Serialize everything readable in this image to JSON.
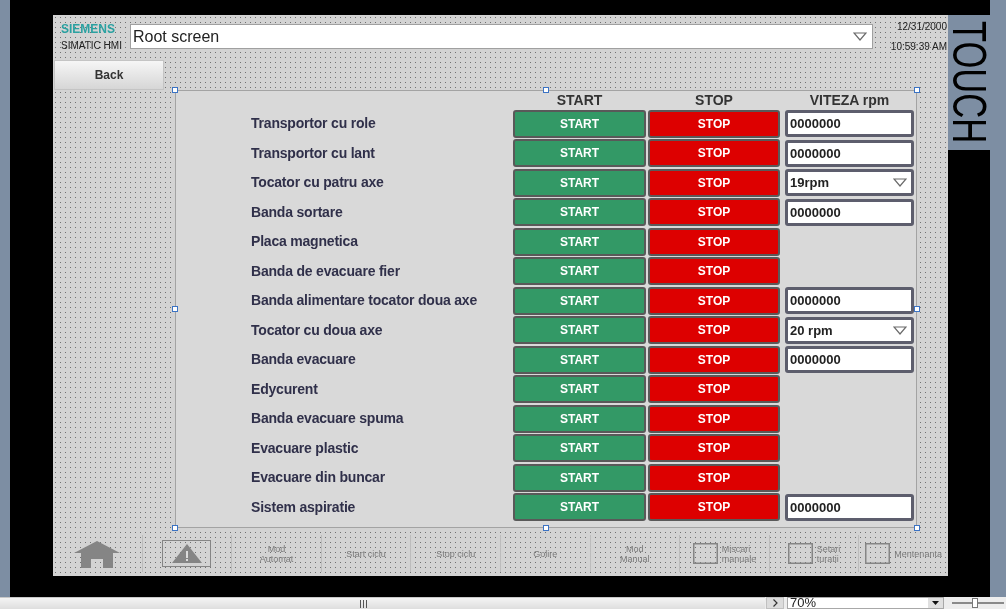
{
  "header": {
    "brand": "SIEMENS",
    "product": "SIMATIC HMI",
    "screen_selector": "Root screen",
    "date": "12/31/2000",
    "time": "10:59:39 AM"
  },
  "side_label": "TOUCH",
  "back_button": "Back",
  "table": {
    "columns": [
      "START",
      "STOP",
      "VITEZA rpm"
    ],
    "rows": [
      {
        "name": "Transportor cu role",
        "start": "START",
        "stop": "STOP",
        "speed": {
          "kind": "input",
          "value": "0000000"
        }
      },
      {
        "name": "Transportor cu lant",
        "start": "START",
        "stop": "STOP",
        "speed": {
          "kind": "input",
          "value": "0000000"
        }
      },
      {
        "name": "Tocator cu patru axe",
        "start": "START",
        "stop": "STOP",
        "speed": {
          "kind": "dropdown",
          "value": "19rpm"
        }
      },
      {
        "name": "Banda sortare",
        "start": "START",
        "stop": "STOP",
        "speed": {
          "kind": "input",
          "value": "0000000"
        }
      },
      {
        "name": "Placa magnetica",
        "start": "START",
        "stop": "STOP"
      },
      {
        "name": "Banda de evacuare fier",
        "start": "START",
        "stop": "STOP"
      },
      {
        "name": "Banda alimentare tocator doua axe",
        "start": "START",
        "stop": "STOP",
        "speed": {
          "kind": "input",
          "value": "0000000"
        }
      },
      {
        "name": "Tocator cu doua axe",
        "start": "START",
        "stop": "STOP",
        "speed": {
          "kind": "dropdown",
          "value": "20 rpm"
        }
      },
      {
        "name": "Banda evacuare",
        "start": "START",
        "stop": "STOP",
        "speed": {
          "kind": "input",
          "value": "0000000"
        }
      },
      {
        "name": "Edycurent",
        "start": "START",
        "stop": "STOP"
      },
      {
        "name": "Banda evacuare spuma",
        "start": "START",
        "stop": "STOP"
      },
      {
        "name": "Evacuare plastic",
        "start": "START",
        "stop": "STOP"
      },
      {
        "name": "Evacuare din buncar",
        "start": "START",
        "stop": "STOP"
      },
      {
        "name": "Sistem aspiratie",
        "start": "START",
        "stop": "STOP",
        "speed": {
          "kind": "input",
          "value": "0000000"
        }
      }
    ]
  },
  "nav_bar": [
    {
      "kind": "home"
    },
    {
      "kind": "alarm"
    },
    {
      "kind": "text",
      "label": "Mod Automat"
    },
    {
      "kind": "text",
      "label": "Start ciclu"
    },
    {
      "kind": "text",
      "label": "Stop ciclu"
    },
    {
      "kind": "text",
      "label": "Golire"
    },
    {
      "kind": "text",
      "label": "Mod Manual"
    },
    {
      "kind": "icon_text",
      "label": "Miscari manuale"
    },
    {
      "kind": "icon_text",
      "label": "Setari turatii"
    },
    {
      "kind": "icon_text",
      "label": "Mentenanta"
    }
  ],
  "editor_bar": {
    "zoom": "70%",
    "zoom_slider": {
      "level": 0.45
    }
  }
}
